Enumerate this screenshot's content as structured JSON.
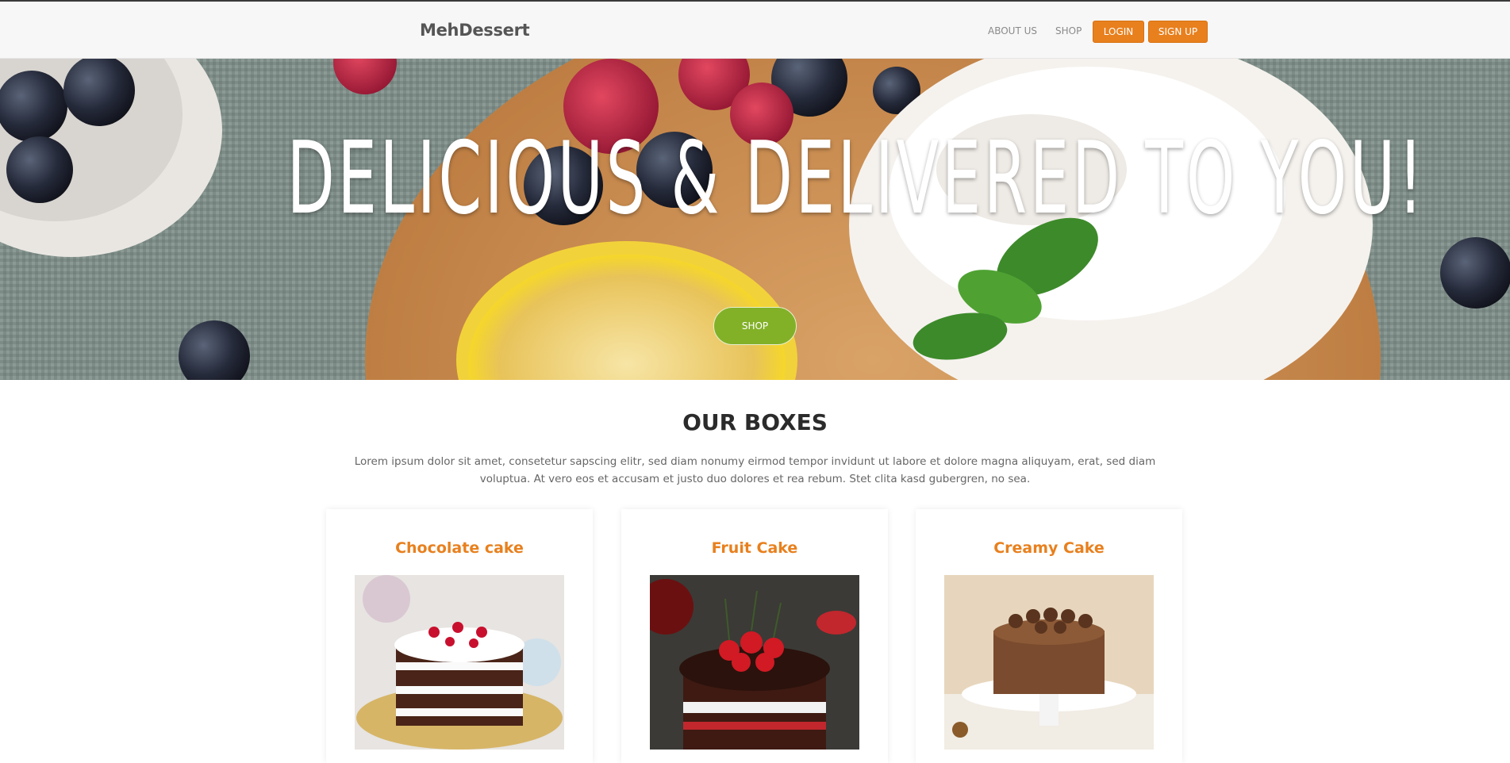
{
  "nav": {
    "brand": "MehDessert",
    "links": [
      "ABOUT US",
      "SHOP"
    ],
    "login": "LOGIN",
    "signup": "SIGN UP"
  },
  "hero": {
    "title": "DELICIOUS & DELIVERED TO YOU!",
    "button": "SHOP"
  },
  "section": {
    "title": "OUR BOXES",
    "text": "Lorem ipsum dolor sit amet, consetetur sapscing elitr, sed diam nonumy eirmod tempor invidunt ut labore et dolore magna aliquyam, erat, sed diam voluptua. At vero eos et accusam et justo duo dolores et rea rebum. Stet clita kasd gubergren, no sea."
  },
  "cards": [
    {
      "title": "Chocolate cake"
    },
    {
      "title": "Fruit Cake"
    },
    {
      "title": "Creamy Cake"
    }
  ],
  "colors": {
    "accent": "#e8801e",
    "shop_button": "#82b128"
  }
}
